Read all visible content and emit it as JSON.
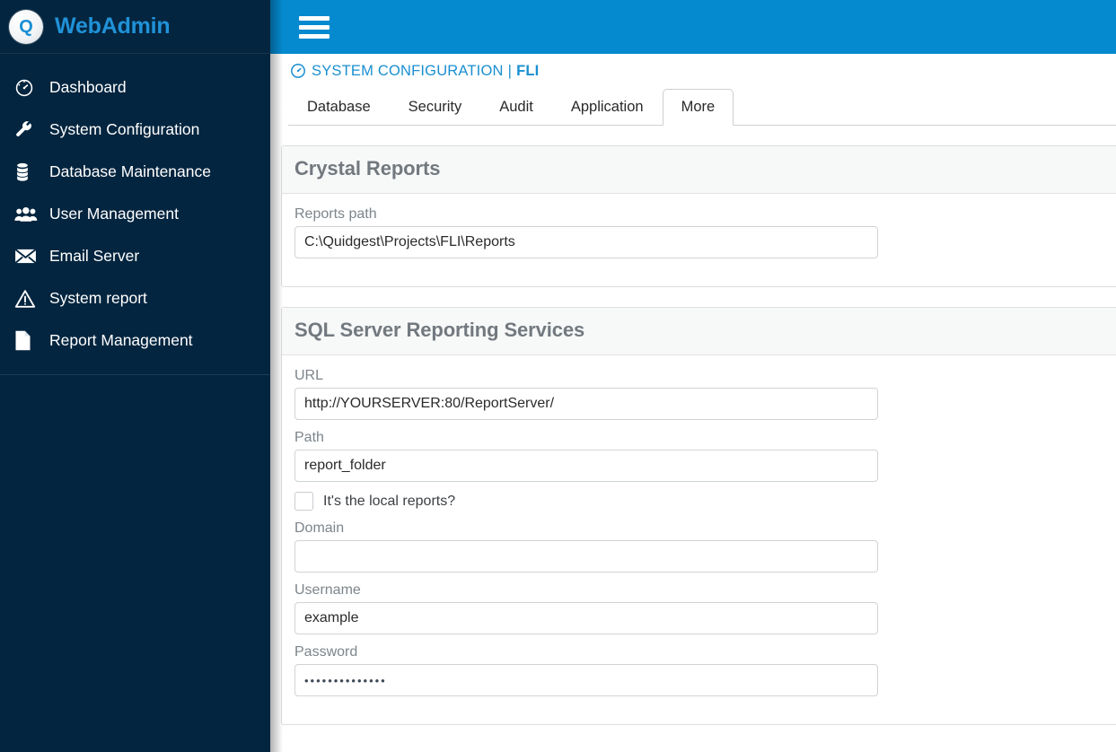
{
  "brand": {
    "logo_letter": "Q",
    "title": "WebAdmin"
  },
  "sidebar": {
    "items": [
      {
        "label": "Dashboard",
        "icon": "gauge-icon"
      },
      {
        "label": "System Configuration",
        "icon": "wrench-icon"
      },
      {
        "label": "Database Maintenance",
        "icon": "database-icon"
      },
      {
        "label": "User Management",
        "icon": "users-icon"
      },
      {
        "label": "Email Server",
        "icon": "envelope-icon"
      },
      {
        "label": "System report",
        "icon": "warning-triangle-icon"
      },
      {
        "label": "Report Management",
        "icon": "document-icon"
      }
    ]
  },
  "topbar": {
    "menu_icon": "hamburger-icon",
    "accent_color": "#0589cf"
  },
  "breadcrumb": {
    "icon": "gauge-icon",
    "section": "SYSTEM CONFIGURATION",
    "separator": "|",
    "app": "FLI"
  },
  "tabs": [
    {
      "label": "Database",
      "active": false
    },
    {
      "label": "Security",
      "active": false
    },
    {
      "label": "Audit",
      "active": false
    },
    {
      "label": "Application",
      "active": false
    },
    {
      "label": "More",
      "active": true
    }
  ],
  "panels": {
    "crystal_reports": {
      "title": "Crystal Reports",
      "reports_path": {
        "label": "Reports path",
        "value": "C:\\Quidgest\\Projects\\FLI\\Reports",
        "placeholder": ""
      }
    },
    "ssrs": {
      "title": "SQL Server Reporting Services",
      "url": {
        "label": "URL",
        "value": "http://YOURSERVER:80/ReportServer/",
        "placeholder": ""
      },
      "path": {
        "label": "Path",
        "value": "report_folder",
        "placeholder": ""
      },
      "local_reports": {
        "label": "It's the local reports?",
        "checked": false
      },
      "domain": {
        "label": "Domain",
        "value": "",
        "placeholder": ""
      },
      "username": {
        "label": "Username",
        "value": "example",
        "placeholder": ""
      },
      "password": {
        "label": "Password",
        "value": "••••••••••••••",
        "placeholder": ""
      }
    }
  }
}
